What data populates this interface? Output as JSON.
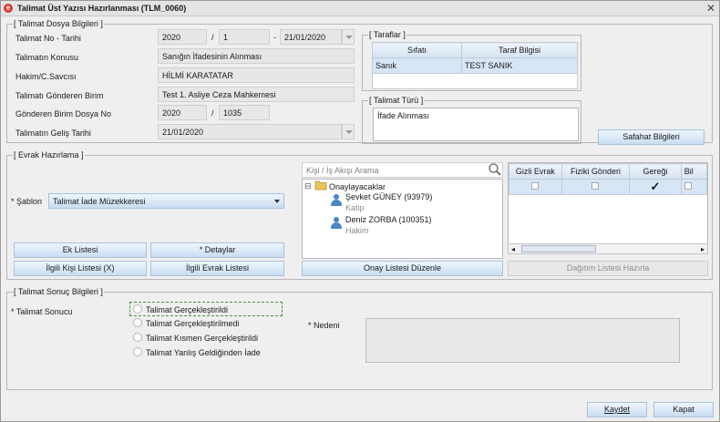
{
  "window": {
    "title": "Talimat Üst Yazısı Hazırlanması (TLM_0060)"
  },
  "dosya": {
    "legend": "[ Talimat Dosya Bilgileri ]",
    "no_tarihi_label": "Talimat No - Tarihi",
    "no_year": "2020",
    "no_sep": "/",
    "no_num": "1",
    "date_sep": "-",
    "date": "21/01/2020",
    "konusu_label": "Talimatın Konusu",
    "konusu": "Sanığın İfadesinin Alınması",
    "hakim_label": "Hakim/C.Savcısı",
    "hakim": "HİLMİ KARATATAR",
    "gonderen_label": "Talimatı Gönderen Birim",
    "gonderen": "Test 1. Asliye Ceza Mahkemesi",
    "dosya_no_label": "Gönderen Birim Dosya No",
    "dosya_year": "2020",
    "dosya_sep": "/",
    "dosya_num": "1035",
    "gelis_label": "Talimatın Geliş Tarihi",
    "gelis": "21/01/2020"
  },
  "taraflar": {
    "legend": "[ Taraflar ]",
    "columns": [
      "Sıfatı",
      "Taraf Bilgisi"
    ],
    "rows": [
      {
        "sifat": "Sanık",
        "bilgi": "TEST SANIK"
      }
    ]
  },
  "turu": {
    "legend": "[ Talimat Türü ]",
    "value": "İfade Alınması"
  },
  "safahat_button": "Safahat Bilgileri",
  "evrak": {
    "legend": "[ Evrak Hazırlama ]",
    "sablon_label": "* Şablon",
    "sablon_value": "Talimat İade Müzekkeresi",
    "ek_listesi": "Ek Listesi",
    "detaylar": "* Detaylar",
    "ilgili_kisi": "İlgili Kişi Listesi (X)",
    "ilgili_evrak": "İlgili Evrak Listesi",
    "search_placeholder": "Kişi / İş Akışı Arama",
    "tree_root": "Onaylayacaklar",
    "tree_expander": "⊟",
    "people": [
      {
        "name": "Şevket GÜNEY (93979)",
        "role": "Katip"
      },
      {
        "name": "Deniz ZORBA (100351)",
        "role": "Hakim"
      }
    ],
    "onay_button": "Onay Listesi Düzenle",
    "dagitim_button": "Dağıtım Listesi Hazırla",
    "dist_columns": [
      "Gizli Evrak",
      "Fiziki Gönderi",
      "Gereği",
      "Bil"
    ],
    "gere_check": "✓"
  },
  "sonuc": {
    "legend": "[ Talimat Sonuç Bilgileri ]",
    "label": "* Talimat Sonucu",
    "options": [
      "Talimat Gerçekleştirildi",
      "Talimat Gerçekleştirilmedi",
      "Talimat Kısmen Gerçekleştirildi",
      "Talimat Yanlış Geldiğinden İade"
    ],
    "nedeni_label": "* Nedeni"
  },
  "footer": {
    "kaydet": "Kaydet",
    "kapat": "Kapat"
  }
}
